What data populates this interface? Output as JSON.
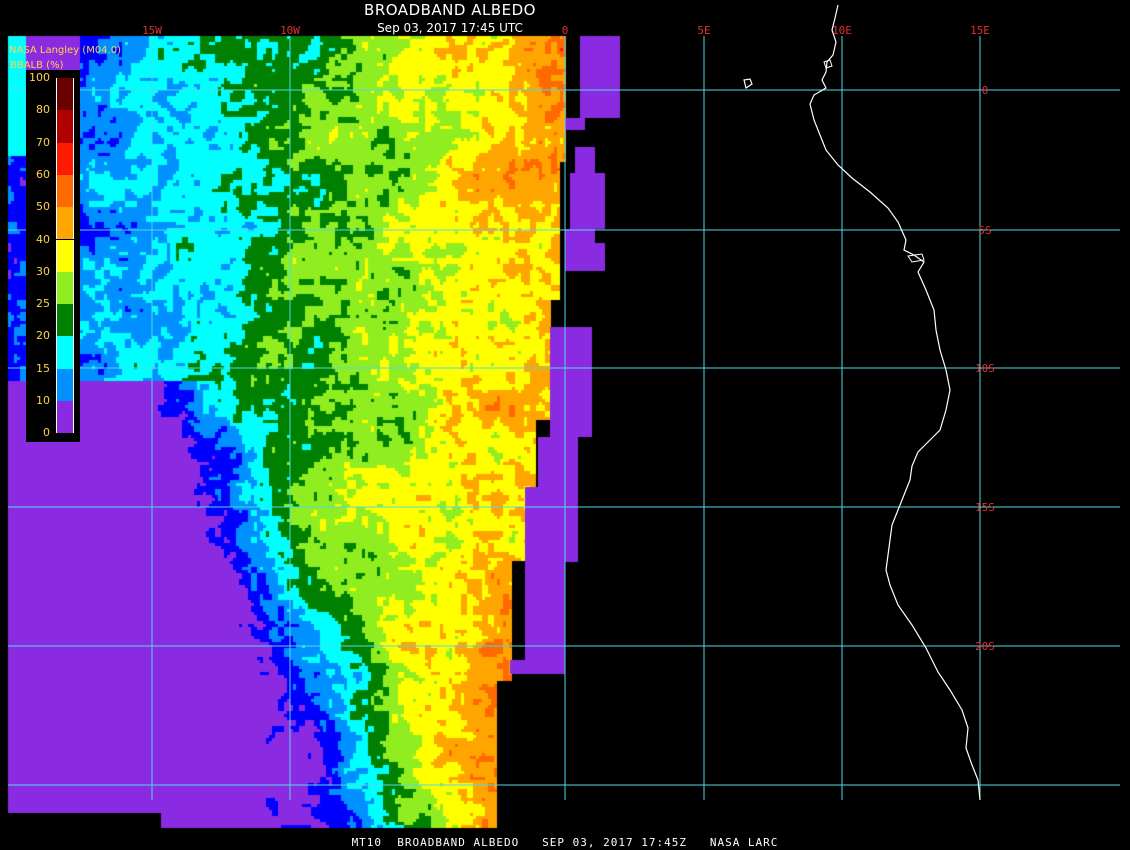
{
  "title": "BROADBAND ALBEDO",
  "timestamp": "Sep 03, 2017 17:45 UTC",
  "provider": "NASA Langley (M04.0)",
  "legend": {
    "label": "BBALB (%)",
    "ticks": [
      "100",
      "80",
      "70",
      "60",
      "50",
      "40",
      "30",
      "25",
      "20",
      "15",
      "10",
      "0"
    ],
    "colors": [
      "#6a0000",
      "#b00000",
      "#ff1a00",
      "#ff6a00",
      "#ffa500",
      "#ffff00",
      "#90ee20",
      "#008000",
      "#00ffff",
      "#0090ff",
      "#0000ff",
      "#8a2be2"
    ]
  },
  "longitude_labels": [
    "15W",
    "10W",
    "0",
    "5E",
    "10E",
    "15E"
  ],
  "latitude_labels": [
    "0",
    "5S",
    "10S",
    "15S",
    "20S"
  ],
  "footer": "MT10  BROADBAND ALBEDO   SEP 03, 2017 17:45Z   NASA LARC",
  "colors": {
    "grid": "#4fd8e8",
    "lon_label": "#e03030",
    "lat_label": "#e03030",
    "coastline": "#ffffff",
    "background": "#000000"
  }
}
